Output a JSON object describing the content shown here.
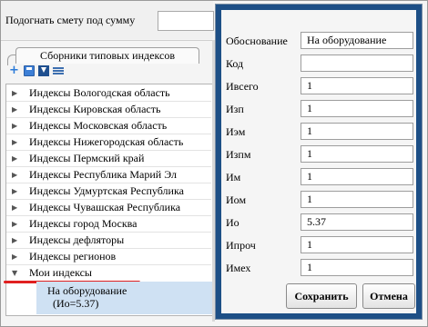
{
  "toolbar": {
    "fit_label": "Подогнать смету под сумму",
    "fit_value": ""
  },
  "tabs": [
    {
      "label": "Сборники типовых индексов"
    }
  ],
  "mini_toolbar": {
    "icons": [
      "add-icon",
      "save-icon",
      "download-icon",
      "list-icon"
    ]
  },
  "tree": {
    "items": [
      {
        "label": "Индексы Вологодская область",
        "expanded": false
      },
      {
        "label": "Индексы Кировская область",
        "expanded": false
      },
      {
        "label": "Индексы Московская область",
        "expanded": false
      },
      {
        "label": "Индексы Нижегородская область",
        "expanded": false
      },
      {
        "label": "Индексы Пермский край",
        "expanded": false
      },
      {
        "label": "Индексы Республика Марий Эл",
        "expanded": false
      },
      {
        "label": "Индексы Удмуртская Республика",
        "expanded": false
      },
      {
        "label": "Индексы Чувашская Республика",
        "expanded": false
      },
      {
        "label": "Индексы город Москва",
        "expanded": false
      },
      {
        "label": "Индексы дефляторы",
        "expanded": false
      },
      {
        "label": "Индексы регионов",
        "expanded": false
      },
      {
        "label": "Мои индексы",
        "expanded": true
      }
    ],
    "selected_child": {
      "line1": "На оборудование",
      "line2": "(Ио=5.37)"
    }
  },
  "dialog": {
    "fields": [
      {
        "label": "Обоснование",
        "value": "На оборудование"
      },
      {
        "label": "Код",
        "value": ""
      },
      {
        "label": "Ивсего",
        "value": "1"
      },
      {
        "label": "Изп",
        "value": "1"
      },
      {
        "label": "Иэм",
        "value": "1"
      },
      {
        "label": "Изпм",
        "value": "1"
      },
      {
        "label": "Им",
        "value": "1"
      },
      {
        "label": "Иом",
        "value": "1"
      },
      {
        "label": "Ио",
        "value": "5.37"
      },
      {
        "label": "Ипроч",
        "value": "1"
      },
      {
        "label": "Имех",
        "value": "1"
      }
    ],
    "save_label": "Сохранить",
    "cancel_label": "Отмена"
  },
  "colors": {
    "dialog_border": "#1d4f86",
    "selection": "#cfe1f3",
    "annotation": "#e02020"
  }
}
